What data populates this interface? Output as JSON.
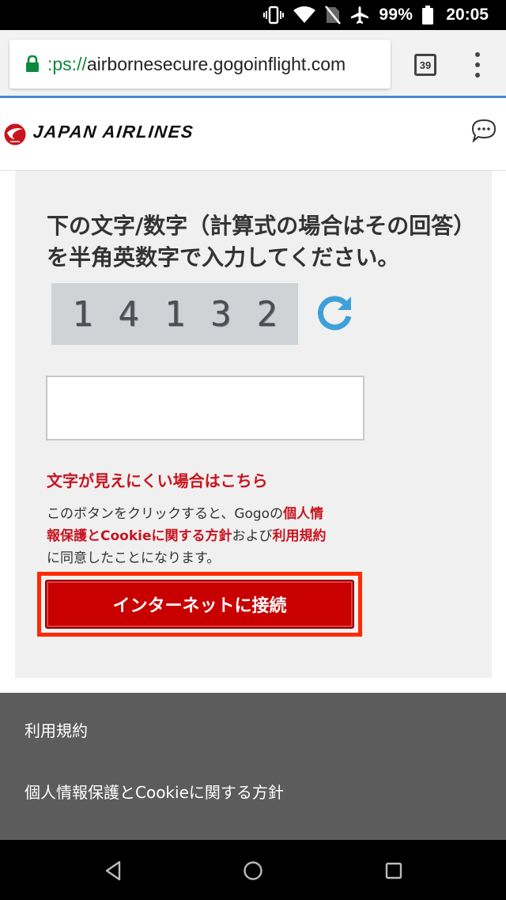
{
  "status_bar": {
    "battery": "99%",
    "time": "20:05",
    "icons": [
      "vibrate-icon",
      "wifi-icon",
      "no-sim-icon",
      "airplane-icon",
      "battery-icon"
    ]
  },
  "browser": {
    "url_scheme": ":ps://",
    "url_host": "airbornesecure.gogoinflight.com",
    "tab_count": "39",
    "colors": {
      "lock": "#0a8a3a",
      "progress": "#4a86d8"
    }
  },
  "header": {
    "brand": "JAPAN AIRLINES",
    "colors": {
      "logo": "#c8141e"
    }
  },
  "form": {
    "instruction": "下の文字/数字（計算式の場合はその回答）を半角英数字で入力してください。",
    "captcha": [
      "1",
      "4",
      "1",
      "3",
      "2"
    ],
    "answer_value": "",
    "hard_to_read_link": "文字が見えにくい場合はこちら",
    "consent": {
      "pre": "このボタンをクリックすると、Gogoの",
      "privacy_link": "個人情報保護とCookieに関する方針",
      "mid": "および",
      "terms_link": "利用規約",
      "post": "に同意したことになります。"
    },
    "connect_button": "インターネットに接続",
    "colors": {
      "accent": "#c8141e",
      "button": "#c80000",
      "highlight": "#ff2a00",
      "refresh": "#3ea0d8"
    }
  },
  "footer": {
    "links": [
      "利用規約",
      "個人情報保護とCookieに関する方針"
    ]
  }
}
